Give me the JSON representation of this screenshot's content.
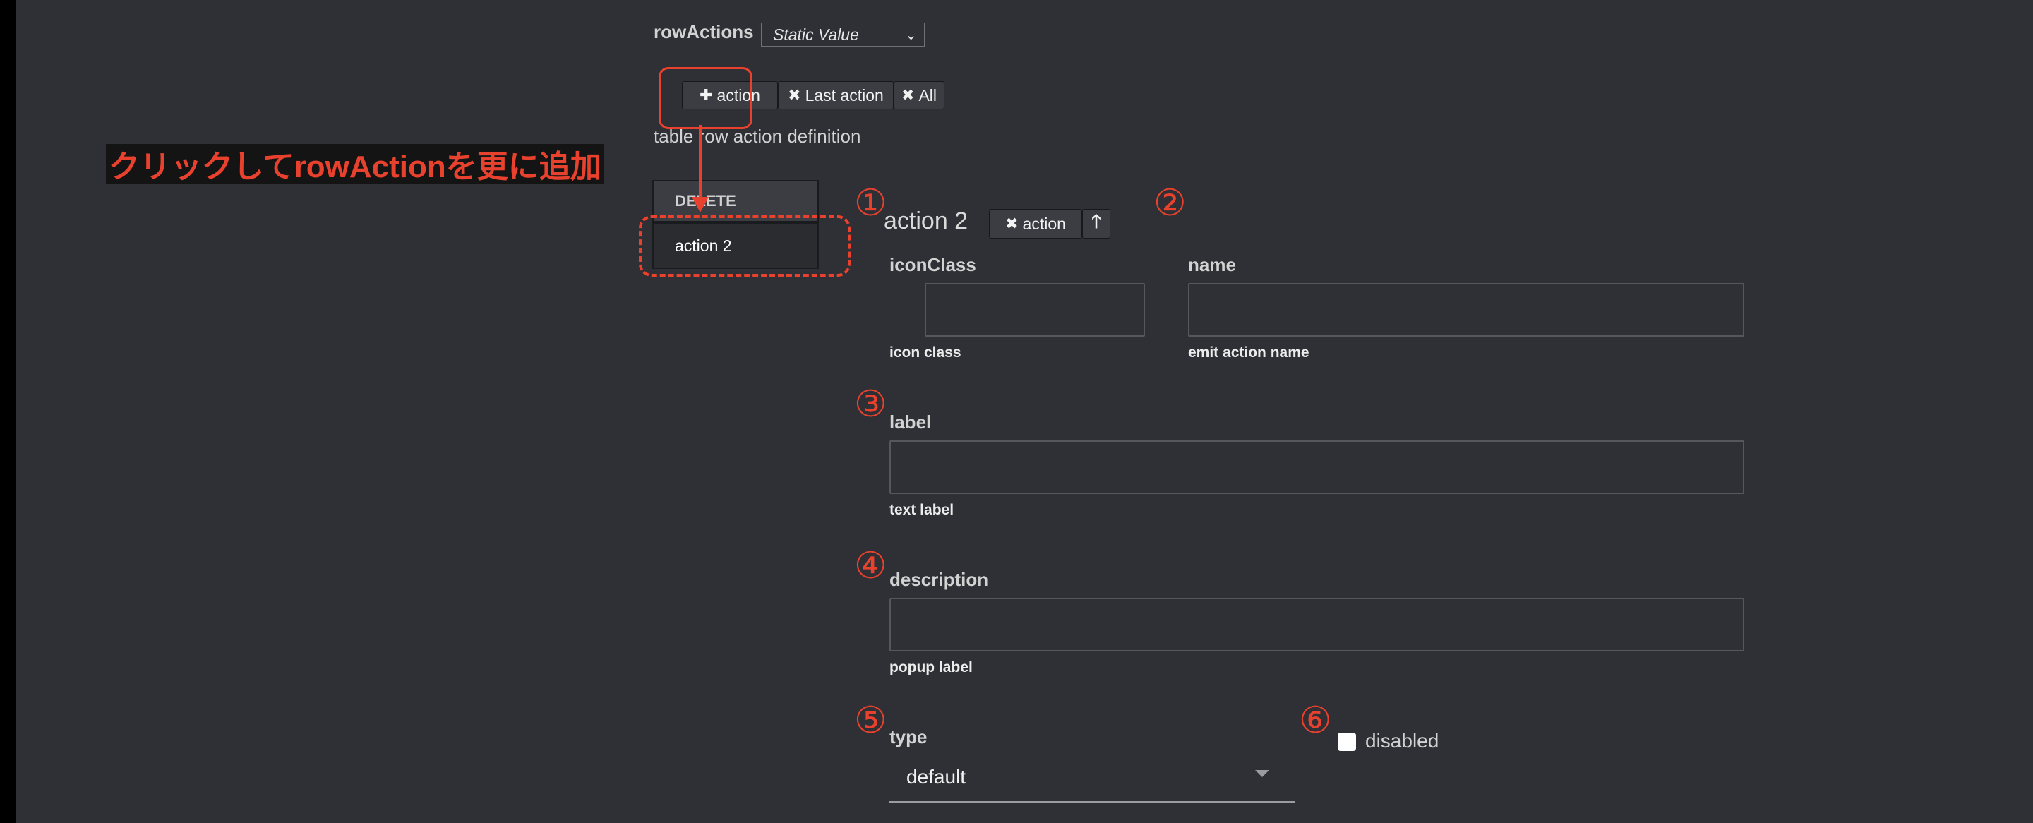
{
  "row_actions": {
    "label": "rowActions",
    "source_select": "Static Value"
  },
  "toolbar": {
    "add_label": "action",
    "remove_last_label": "Last action",
    "remove_all_label": "All"
  },
  "definition_title": "table row action definition",
  "callout_text": "クリックしてrowActionを更に追加",
  "action_list": [
    "DELETE",
    "action 2"
  ],
  "editor": {
    "title": "action 2",
    "remove_label": "action",
    "icon_class": {
      "label": "iconClass",
      "value": "",
      "hint": "icon class"
    },
    "name": {
      "label": "name",
      "value": "",
      "hint": "emit action name"
    },
    "text_label": {
      "label": "label",
      "value": "",
      "hint": "text label"
    },
    "description": {
      "label": "description",
      "value": "",
      "hint": "popup label"
    },
    "type": {
      "label": "type",
      "value": "default"
    },
    "disabled": {
      "label": "disabled",
      "checked": false
    }
  },
  "markers": [
    "①",
    "②",
    "③",
    "④",
    "⑤",
    "⑥"
  ],
  "colors": {
    "background": "#2e3035",
    "annotation": "#e8412d",
    "button": "#3b3d43"
  }
}
